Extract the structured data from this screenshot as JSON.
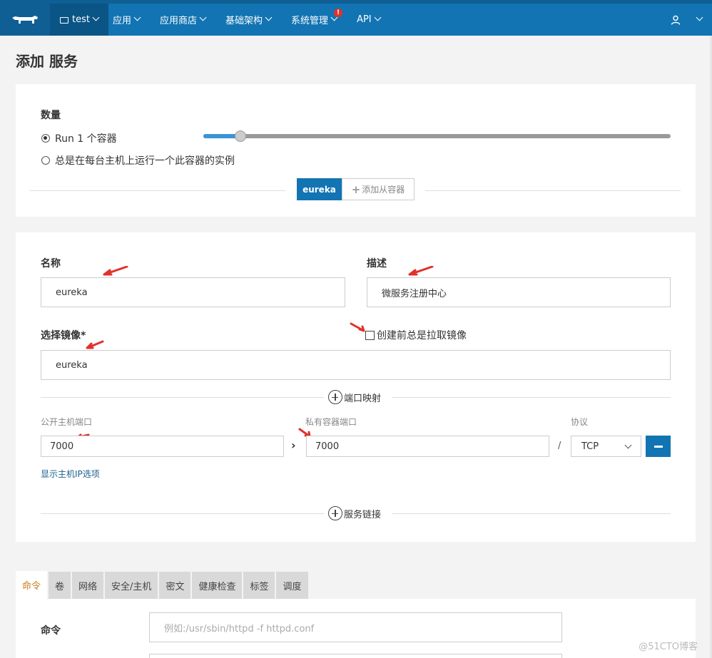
{
  "nav": {
    "env": "test",
    "items": [
      "应用",
      "应用商店",
      "基础架构",
      "系统管理",
      "API"
    ],
    "alert": "!"
  },
  "page": {
    "title": "添加 服务"
  },
  "scale": {
    "label": "数量",
    "option_run": "Run 1 个容器",
    "option_each_host": "总是在每台主机上运行一个此容器的实例",
    "slider_fraction": 0.08
  },
  "container_tabs": {
    "active": "eureka",
    "add": "添加从容器"
  },
  "form": {
    "name_label": "名称",
    "name_value": "eureka",
    "desc_label": "描述",
    "desc_value": "微服务注册中心",
    "image_label": "选择镜像*",
    "image_value": "eureka",
    "pull_label": "创建前总是拉取镜像"
  },
  "ports": {
    "section": "端口映射",
    "public_label": "公开主机端口",
    "private_label": "私有容器端口",
    "protocol_label": "协议",
    "public_value": "7000",
    "private_value": "7000",
    "separator": "/",
    "protocol_value": "TCP",
    "show_ip_link": "显示主机IP选项",
    "links_section": "服务链接"
  },
  "tabs": [
    "命令",
    "卷",
    "网络",
    "安全/主机",
    "密文",
    "健康检查",
    "标签",
    "调度"
  ],
  "command": {
    "label": "命令",
    "placeholder": "例如:/usr/sbin/httpd -f httpd.conf"
  },
  "watermark": "@51CTO博客",
  "colors": {
    "nav": "#1274b3",
    "accent": "#1274b3",
    "arrow": "#e0322c",
    "active_tab_text": "#c77c1b"
  }
}
